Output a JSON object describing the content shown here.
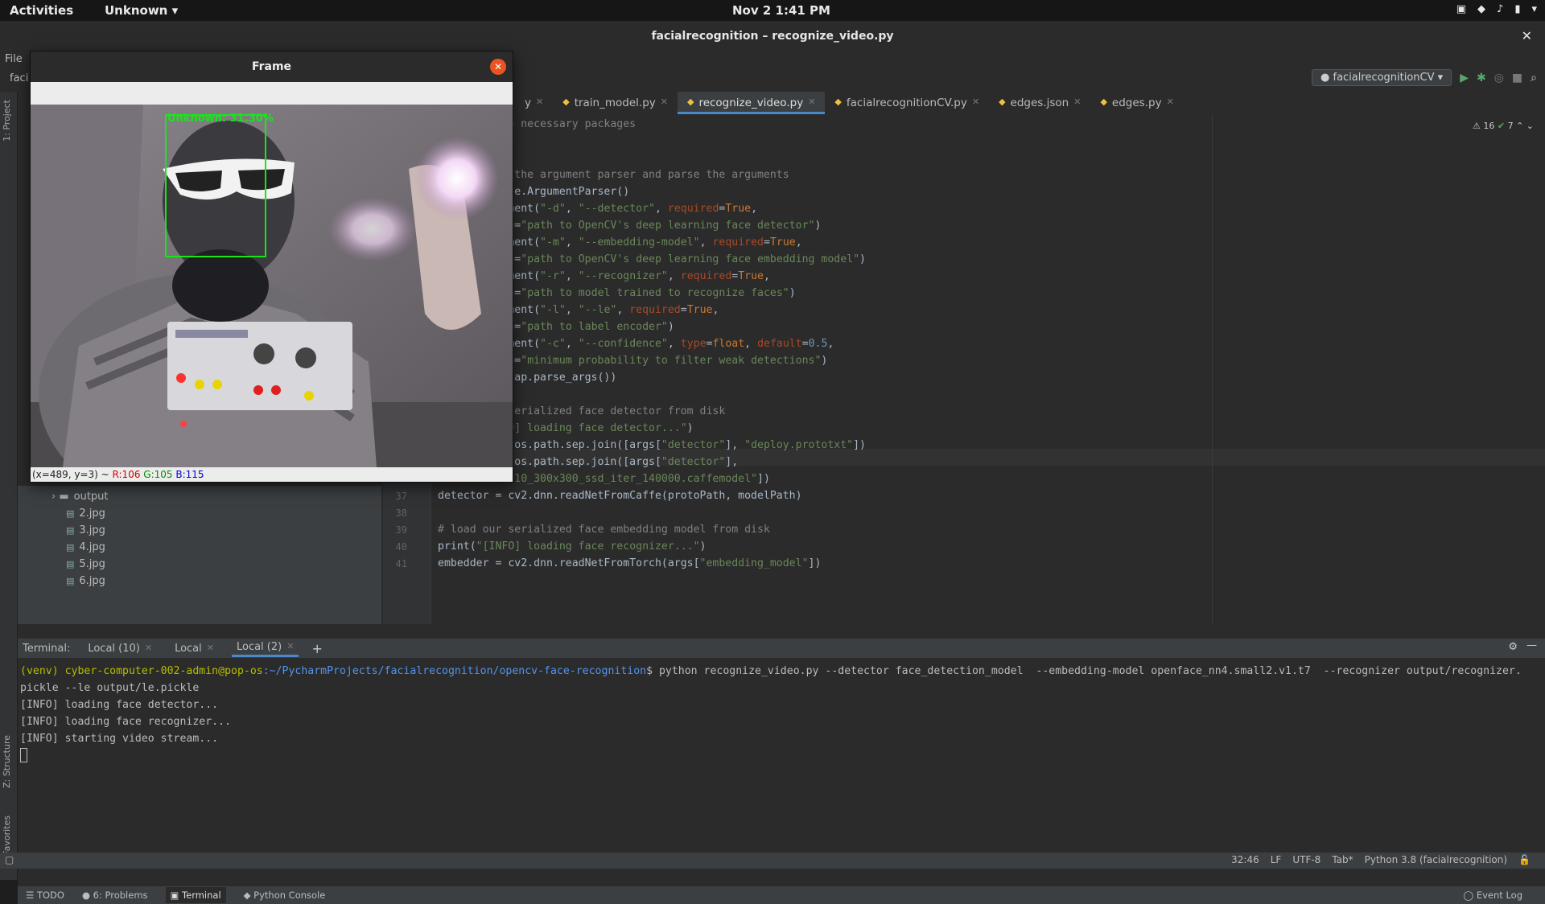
{
  "topbar": {
    "activities": "Activities",
    "app_menu": "Unknown",
    "clock": "Nov 2  1:41 PM"
  },
  "window": {
    "title": "facialrecognition – recognize_video.py"
  },
  "ide": {
    "menu_file": "File",
    "project_label": "faci",
    "run_config": "facialrecognitionCV",
    "side_labels": {
      "project": "1: Project",
      "structure": "Z: Structure",
      "favorites": "2: Favorites"
    },
    "tabs": [
      {
        "label": "y"
      },
      {
        "label": "train_model.py"
      },
      {
        "label": "recognize_video.py"
      },
      {
        "label": "facialrecognitionCV.py"
      },
      {
        "label": "edges.json"
      },
      {
        "label": "edges.py"
      }
    ],
    "inspections": {
      "warnings": "16",
      "ok": "7"
    }
  },
  "code": {
    "lines": [
      {
        "n": "",
        "parts": [
          {
            "c": "comment",
            "t": "# import the necessary packages"
          }
        ]
      },
      {
        "n": "",
        "parts": []
      },
      {
        "n": "",
        "parts": []
      },
      {
        "n": "",
        "parts": [
          {
            "c": "comment",
            "t": "# construct the argument parser and parse the arguments"
          }
        ]
      },
      {
        "n": "",
        "parts": [
          {
            "c": "",
            "t": "ap = argparse.ArgumentParser()"
          }
        ]
      },
      {
        "n": "",
        "parts": [
          {
            "c": "",
            "t": "ap.add_argument("
          },
          {
            "c": "str",
            "t": "\"-d\""
          },
          {
            "c": "",
            "t": ", "
          },
          {
            "c": "str",
            "t": "\"--detector\""
          },
          {
            "c": "",
            "t": ", "
          },
          {
            "c": "param",
            "t": "required"
          },
          {
            "c": "",
            "t": "="
          },
          {
            "c": "kw",
            "t": "True"
          },
          {
            "c": "",
            "t": ","
          }
        ]
      },
      {
        "n": "",
        "parts": [
          {
            "c": "",
            "t": "\t"
          },
          {
            "c": "param",
            "t": "help"
          },
          {
            "c": "",
            "t": "="
          },
          {
            "c": "str",
            "t": "\"path to OpenCV's deep learning face detector\""
          },
          {
            "c": "",
            "t": ")"
          }
        ]
      },
      {
        "n": "",
        "parts": [
          {
            "c": "",
            "t": "ap.add_argument("
          },
          {
            "c": "str",
            "t": "\"-m\""
          },
          {
            "c": "",
            "t": ", "
          },
          {
            "c": "str",
            "t": "\"--embedding-model\""
          },
          {
            "c": "",
            "t": ", "
          },
          {
            "c": "param",
            "t": "required"
          },
          {
            "c": "",
            "t": "="
          },
          {
            "c": "kw",
            "t": "True"
          },
          {
            "c": "",
            "t": ","
          }
        ]
      },
      {
        "n": "",
        "parts": [
          {
            "c": "",
            "t": "\t"
          },
          {
            "c": "param",
            "t": "help"
          },
          {
            "c": "",
            "t": "="
          },
          {
            "c": "str",
            "t": "\"path to OpenCV's deep learning face embedding model\""
          },
          {
            "c": "",
            "t": ")"
          }
        ]
      },
      {
        "n": "",
        "parts": [
          {
            "c": "",
            "t": "ap.add_argument("
          },
          {
            "c": "str",
            "t": "\"-r\""
          },
          {
            "c": "",
            "t": ", "
          },
          {
            "c": "str",
            "t": "\"--recognizer\""
          },
          {
            "c": "",
            "t": ", "
          },
          {
            "c": "param",
            "t": "required"
          },
          {
            "c": "",
            "t": "="
          },
          {
            "c": "kw",
            "t": "True"
          },
          {
            "c": "",
            "t": ","
          }
        ]
      },
      {
        "n": "",
        "parts": [
          {
            "c": "",
            "t": "\t"
          },
          {
            "c": "param",
            "t": "help"
          },
          {
            "c": "",
            "t": "="
          },
          {
            "c": "str",
            "t": "\"path to model trained to recognize faces\""
          },
          {
            "c": "",
            "t": ")"
          }
        ]
      },
      {
        "n": "",
        "parts": [
          {
            "c": "",
            "t": "ap.add_argument("
          },
          {
            "c": "str",
            "t": "\"-l\""
          },
          {
            "c": "",
            "t": ", "
          },
          {
            "c": "str",
            "t": "\"--le\""
          },
          {
            "c": "",
            "t": ", "
          },
          {
            "c": "param",
            "t": "required"
          },
          {
            "c": "",
            "t": "="
          },
          {
            "c": "kw",
            "t": "True"
          },
          {
            "c": "",
            "t": ","
          }
        ]
      },
      {
        "n": "",
        "parts": [
          {
            "c": "",
            "t": "\t"
          },
          {
            "c": "param",
            "t": "help"
          },
          {
            "c": "",
            "t": "="
          },
          {
            "c": "str",
            "t": "\"path to label encoder\""
          },
          {
            "c": "",
            "t": ")"
          }
        ]
      },
      {
        "n": "",
        "parts": [
          {
            "c": "",
            "t": "ap.add_argument("
          },
          {
            "c": "str",
            "t": "\"-c\""
          },
          {
            "c": "",
            "t": ", "
          },
          {
            "c": "str",
            "t": "\"--confidence\""
          },
          {
            "c": "",
            "t": ", "
          },
          {
            "c": "param",
            "t": "type"
          },
          {
            "c": "",
            "t": "="
          },
          {
            "c": "kw",
            "t": "float"
          },
          {
            "c": "",
            "t": ", "
          },
          {
            "c": "param",
            "t": "default"
          },
          {
            "c": "",
            "t": "="
          },
          {
            "c": "num",
            "t": "0.5"
          },
          {
            "c": "",
            "t": ","
          }
        ]
      },
      {
        "n": "",
        "parts": [
          {
            "c": "",
            "t": "\t"
          },
          {
            "c": "param",
            "t": "help"
          },
          {
            "c": "",
            "t": "="
          },
          {
            "c": "str",
            "t": "\"minimum probability to filter weak detections\""
          },
          {
            "c": "",
            "t": ")"
          }
        ]
      },
      {
        "n": "",
        "parts": [
          {
            "c": "",
            "t": "args = vars(ap.parse_args())"
          }
        ]
      },
      {
        "n": "",
        "parts": []
      },
      {
        "n": "",
        "parts": [
          {
            "c": "comment",
            "t": "# load our serialized face detector from disk"
          }
        ]
      },
      {
        "n": "",
        "parts": [
          {
            "c": "",
            "t": "print("
          },
          {
            "c": "str",
            "t": "\"[INFO] loading face detector...\""
          },
          {
            "c": "",
            "t": ")"
          }
        ]
      },
      {
        "n": "",
        "parts": [
          {
            "c": "",
            "t": "protoPath = os.path.sep.join([args["
          },
          {
            "c": "str",
            "t": "\"detector\""
          },
          {
            "c": "",
            "t": "], "
          },
          {
            "c": "str",
            "t": "\"deploy.prototxt\""
          },
          {
            "c": "",
            "t": "])"
          }
        ]
      },
      {
        "n": "",
        "parts": [
          {
            "c": "",
            "t": "modelPath = os.path.sep.join([args["
          },
          {
            "c": "str",
            "t": "\"detector\""
          },
          {
            "c": "",
            "t": "],"
          }
        ]
      },
      {
        "n": "",
        "parts": [
          {
            "c": "",
            "t": "\t"
          },
          {
            "c": "str",
            "t": "\"res10_300x300_ssd_iter_140000.caffemodel\""
          },
          {
            "c": "",
            "t": "])"
          }
        ]
      },
      {
        "n": "37",
        "parts": [
          {
            "c": "",
            "t": "detector = cv2.dnn.readNetFromCaffe(protoPath, modelPath)"
          }
        ]
      },
      {
        "n": "38",
        "parts": []
      },
      {
        "n": "39",
        "parts": [
          {
            "c": "comment",
            "t": "# load our serialized face embedding model from disk"
          }
        ]
      },
      {
        "n": "40",
        "parts": [
          {
            "c": "",
            "t": "print("
          },
          {
            "c": "str",
            "t": "\"[INFO] loading face recognizer...\""
          },
          {
            "c": "",
            "t": ")"
          }
        ]
      },
      {
        "n": "41",
        "parts": [
          {
            "c": "",
            "t": "embedder = cv2.dnn.readNetFromTorch(args["
          },
          {
            "c": "str",
            "t": "\"embedding_model\""
          },
          {
            "c": "",
            "t": "])"
          }
        ]
      }
    ]
  },
  "project_tree": {
    "items": [
      {
        "kind": "folder",
        "label": "output"
      },
      {
        "kind": "file",
        "label": "2.jpg"
      },
      {
        "kind": "file",
        "label": "3.jpg"
      },
      {
        "kind": "file",
        "label": "4.jpg"
      },
      {
        "kind": "file",
        "label": "5.jpg"
      },
      {
        "kind": "file",
        "label": "6.jpg"
      }
    ]
  },
  "terminal": {
    "header_label": "Terminal:",
    "tabs": [
      {
        "label": "Local (10)"
      },
      {
        "label": "Local"
      },
      {
        "label": "Local (2)"
      }
    ],
    "prompt_user": "(venv) cyber-computer-002-admin@pop-os",
    "prompt_path": ":~/PycharmProjects/facialrecognition/opencv-face-recognition",
    "command": "$ python recognize_video.py --detector face_detection_model  --embedding-model openface_nn4.small2.v1.t7  --recognizer output/recognizer.",
    "lines": [
      "pickle --le output/le.pickle",
      "[INFO] loading face detector...",
      "[INFO] loading face recognizer...",
      "[INFO] starting video stream..."
    ]
  },
  "bottom_tools": {
    "todo": "TODO",
    "problems": "6: Problems",
    "terminal": "Terminal",
    "python_console": "Python Console",
    "event_log": "Event Log"
  },
  "status": {
    "position": "32:46",
    "line_sep": "LF",
    "encoding": "UTF-8",
    "indent": "Tab*",
    "interpreter": "Python 3.8 (facialrecognition)"
  },
  "frame_window": {
    "title": "Frame",
    "overlay_label": "Unknown: 31.30%",
    "coords": "(x=489, y=3) ~",
    "r": "R:106",
    "g": "G:105",
    "b": "B:115"
  }
}
